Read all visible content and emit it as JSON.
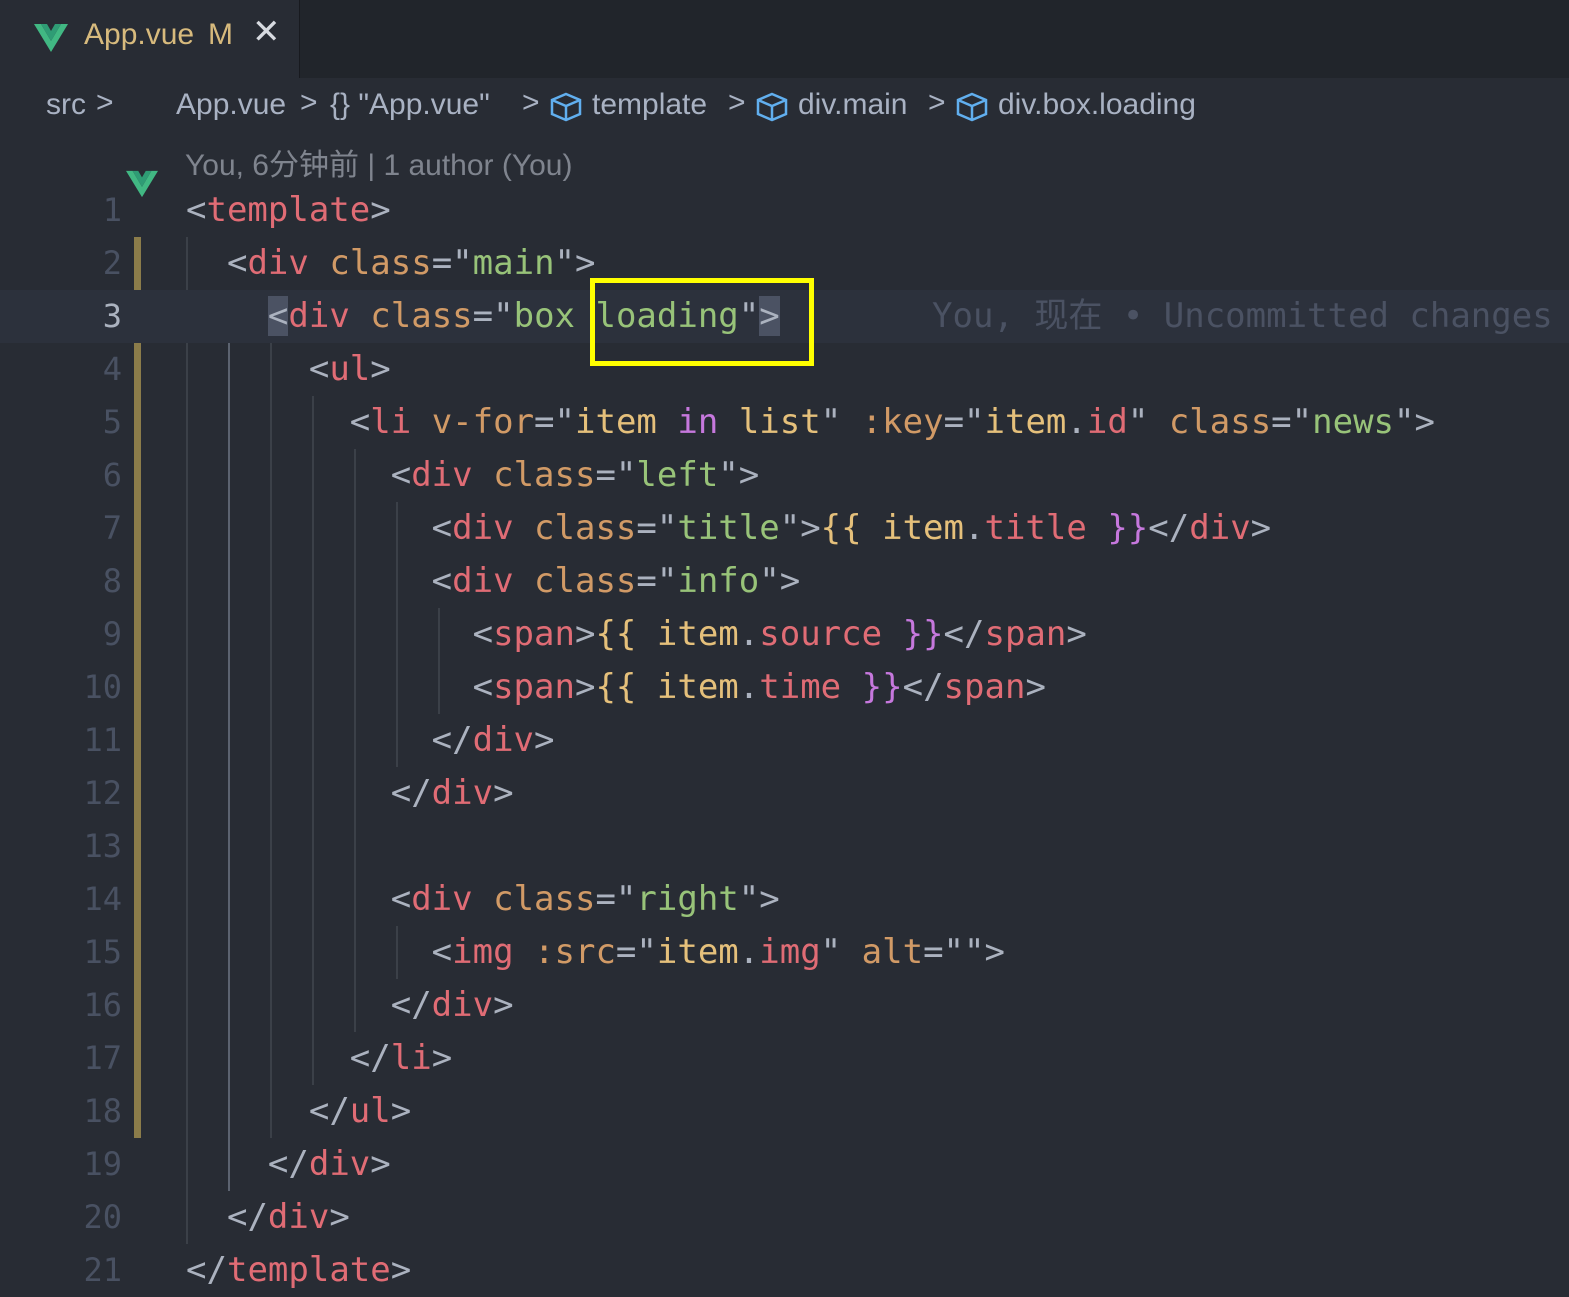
{
  "tab": {
    "name": "App.vue",
    "status": "M",
    "close": "✕"
  },
  "breadcrumb": {
    "items": [
      "src",
      "App.vue",
      "{} \"App.vue\"",
      "template",
      "div.main",
      "div.box.loading"
    ],
    "separator": ">"
  },
  "blame_header": "You, 6分钟前 | 1 author (You)",
  "inline_blame": "You, 现在 • Uncommitted changes",
  "current_line": 3,
  "line_numbers": [
    "1",
    "2",
    "3",
    "4",
    "5",
    "6",
    "7",
    "8",
    "9",
    "10",
    "11",
    "12",
    "13",
    "14",
    "15",
    "16",
    "17",
    "18",
    "19",
    "20",
    "21"
  ],
  "code_lines": [
    "<template>",
    "  <div class=\"main\">",
    "    <div class=\"box loading\">",
    "      <ul>",
    "        <li v-for=\"item in list\" :key=\"item.id\" class=\"news\">",
    "          <div class=\"left\">",
    "            <div class=\"title\">{{ item.title }}</div>",
    "            <div class=\"info\">",
    "              <span>{{ item.source }}</span>",
    "              <span>{{ item.time }}</span>",
    "            </div>",
    "          </div>",
    "",
    "          <div class=\"right\">",
    "            <img :src=\"item.img\" alt=\"\">",
    "          </div>",
    "        </li>",
    "      </ul>",
    "    </div>",
    "  </div>",
    "</template>"
  ],
  "colors": {
    "background": "#282c34",
    "tag": "#e06c75",
    "attribute": "#d19a66",
    "string": "#98c379",
    "keyword": "#c678dd",
    "variable": "#e5c07b",
    "highlight_box": "#ffff00",
    "vue_green": "#41b883"
  }
}
